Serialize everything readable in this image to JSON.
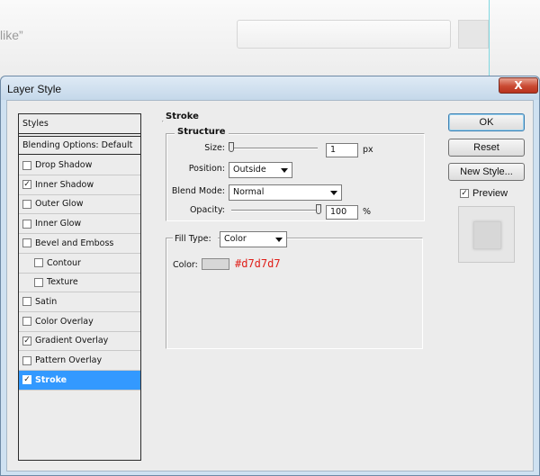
{
  "background": {
    "partial_text": "like”"
  },
  "dialog": {
    "title": "Layer Style",
    "close_glyph": "X"
  },
  "styles_panel": {
    "header": "Styles",
    "blending_options": "Blending Options: Default",
    "items": [
      {
        "label": "Drop Shadow",
        "checked": false,
        "indent": false,
        "selected": false
      },
      {
        "label": "Inner Shadow",
        "checked": true,
        "indent": false,
        "selected": false
      },
      {
        "label": "Outer Glow",
        "checked": false,
        "indent": false,
        "selected": false
      },
      {
        "label": "Inner Glow",
        "checked": false,
        "indent": false,
        "selected": false
      },
      {
        "label": "Bevel and Emboss",
        "checked": false,
        "indent": false,
        "selected": false
      },
      {
        "label": "Contour",
        "checked": false,
        "indent": true,
        "selected": false
      },
      {
        "label": "Texture",
        "checked": false,
        "indent": true,
        "selected": false
      },
      {
        "label": "Satin",
        "checked": false,
        "indent": false,
        "selected": false
      },
      {
        "label": "Color Overlay",
        "checked": false,
        "indent": false,
        "selected": false
      },
      {
        "label": "Gradient Overlay",
        "checked": true,
        "indent": false,
        "selected": false
      },
      {
        "label": "Pattern Overlay",
        "checked": false,
        "indent": false,
        "selected": false
      },
      {
        "label": "Stroke",
        "checked": true,
        "indent": false,
        "selected": true
      }
    ]
  },
  "stroke": {
    "title": "Stroke",
    "structure_title": "Structure",
    "size_label": "Size:",
    "size_value": "1",
    "size_unit": "px",
    "position_label": "Position:",
    "position_value": "Outside",
    "blend_mode_label": "Blend Mode:",
    "blend_mode_value": "Normal",
    "opacity_label": "Opacity:",
    "opacity_value": "100",
    "opacity_unit": "%",
    "fill_type_label": "Fill Type:",
    "fill_type_value": "Color",
    "color_label": "Color:",
    "color_hex_annotation": "#d7d7d7",
    "color_swatch": "#d7d7d7"
  },
  "buttons": {
    "ok": "OK",
    "reset": "Reset",
    "new_style": "New Style...",
    "preview": "Preview",
    "preview_checked": true
  },
  "colors": {
    "selection": "#3399ff",
    "annotation": "#e0201a",
    "dialog_bg": "#ececec"
  }
}
